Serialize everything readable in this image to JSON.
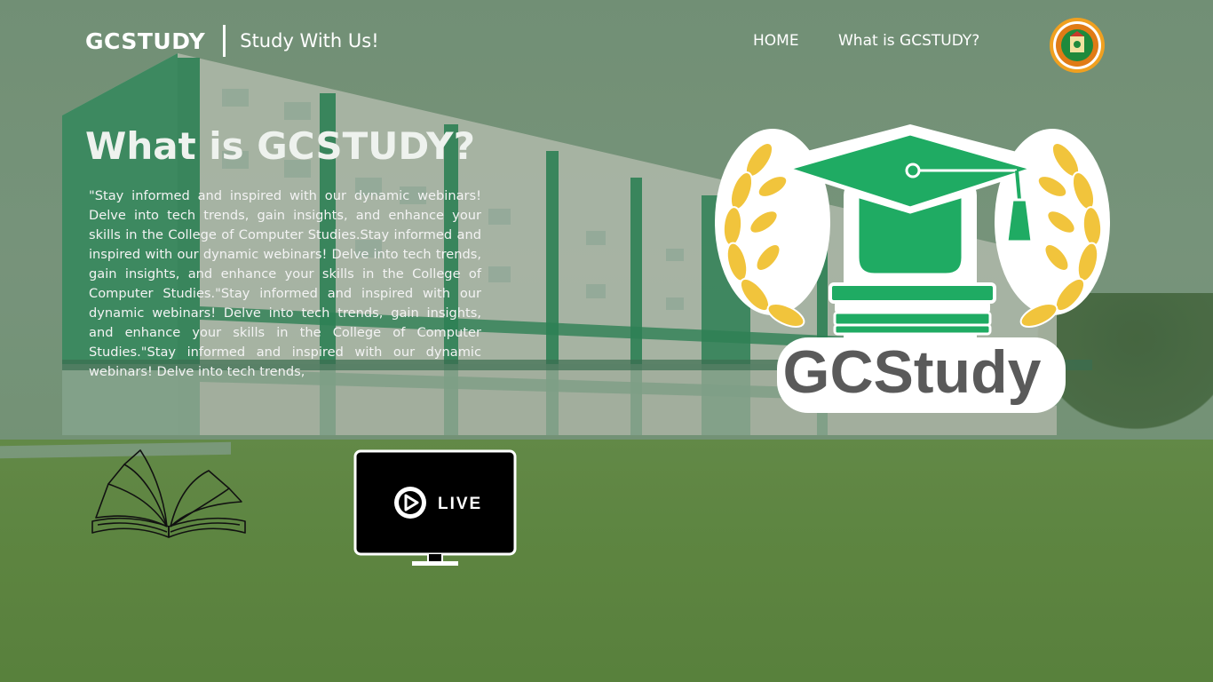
{
  "header": {
    "brand": "GCSTUDY",
    "tagline": "Study With Us!",
    "nav": [
      {
        "label": "HOME"
      },
      {
        "label": "What is GCSTUDY?"
      }
    ],
    "seal_icon": "college-seal-icon"
  },
  "main": {
    "title": "What is GCSTUDY?",
    "description": "\"Stay informed and inspired with our dynamic webinars! Delve into tech trends, gain insights, and enhance your skills in the College of Computer Studies.Stay informed and inspired with our dynamic webinars! Delve into tech trends, gain insights, and enhance your skills in the College of Computer Studies.\"Stay informed and inspired with our dynamic webinars! Delve into tech trends, gain insights, and enhance your skills in the College of Computer Studies.\"Stay informed and inspired with our dynamic webinars! Delve into tech trends,",
    "live_label": "LIVE",
    "logo_text": "GCStudy",
    "icons": [
      "open-book-icon",
      "live-monitor-icon",
      "graduation-cap-logo-icon"
    ]
  },
  "colors": {
    "accent_green": "#1fab63",
    "laurel_gold": "#f1c43c",
    "logo_text": "#5a5a5a",
    "text_white": "#ffffff"
  }
}
